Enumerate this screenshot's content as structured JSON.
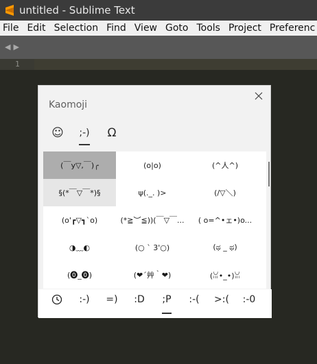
{
  "window": {
    "title": "untitled - Sublime Text",
    "icon": "sublime-logo"
  },
  "menu": [
    "File",
    "Edit",
    "Selection",
    "Find",
    "View",
    "Goto",
    "Tools",
    "Project",
    "Preferenc"
  ],
  "editor": {
    "line_numbers": [
      "1"
    ]
  },
  "panel": {
    "title": "Kaomoji",
    "close_icon": "close-icon",
    "category_tabs": [
      {
        "label": "☺",
        "name": "emoji"
      },
      {
        "label": ";-)",
        "name": "kaomoji",
        "active": true
      },
      {
        "label": "Ω",
        "name": "symbols"
      }
    ],
    "kaomoji": [
      [
        "(￣y▽,￣)╭",
        "(o|o)",
        "(^人^)"
      ],
      [
        "§(*￣▽￣*)§",
        "ψ(._. )>",
        "(/▽＼)"
      ],
      [
        "(o'┏▽┓`o)",
        "(*≧︶≦))(￣▽￣...",
        "( o=^•ェ•)o..."
      ],
      [
        "◑﹏◐",
        "(○ ` 3'○)",
        "(ಥ _ ಥ)"
      ],
      [
        "(⓿_⓿)",
        "(❤´艸｀❤)",
        "(ꈍ•_•)ꈍ"
      ]
    ],
    "selected_index": [
      0,
      0
    ],
    "hover_index": [
      1,
      0
    ],
    "bottom_tabs": [
      {
        "label": "🕓",
        "name": "recent"
      },
      {
        "label": ":-)"
      },
      {
        "label": "=)"
      },
      {
        "label": ":D"
      },
      {
        "label": ";P",
        "active": true
      },
      {
        "label": ":-("
      },
      {
        "label": ">:("
      },
      {
        "label": ":-0"
      }
    ]
  }
}
